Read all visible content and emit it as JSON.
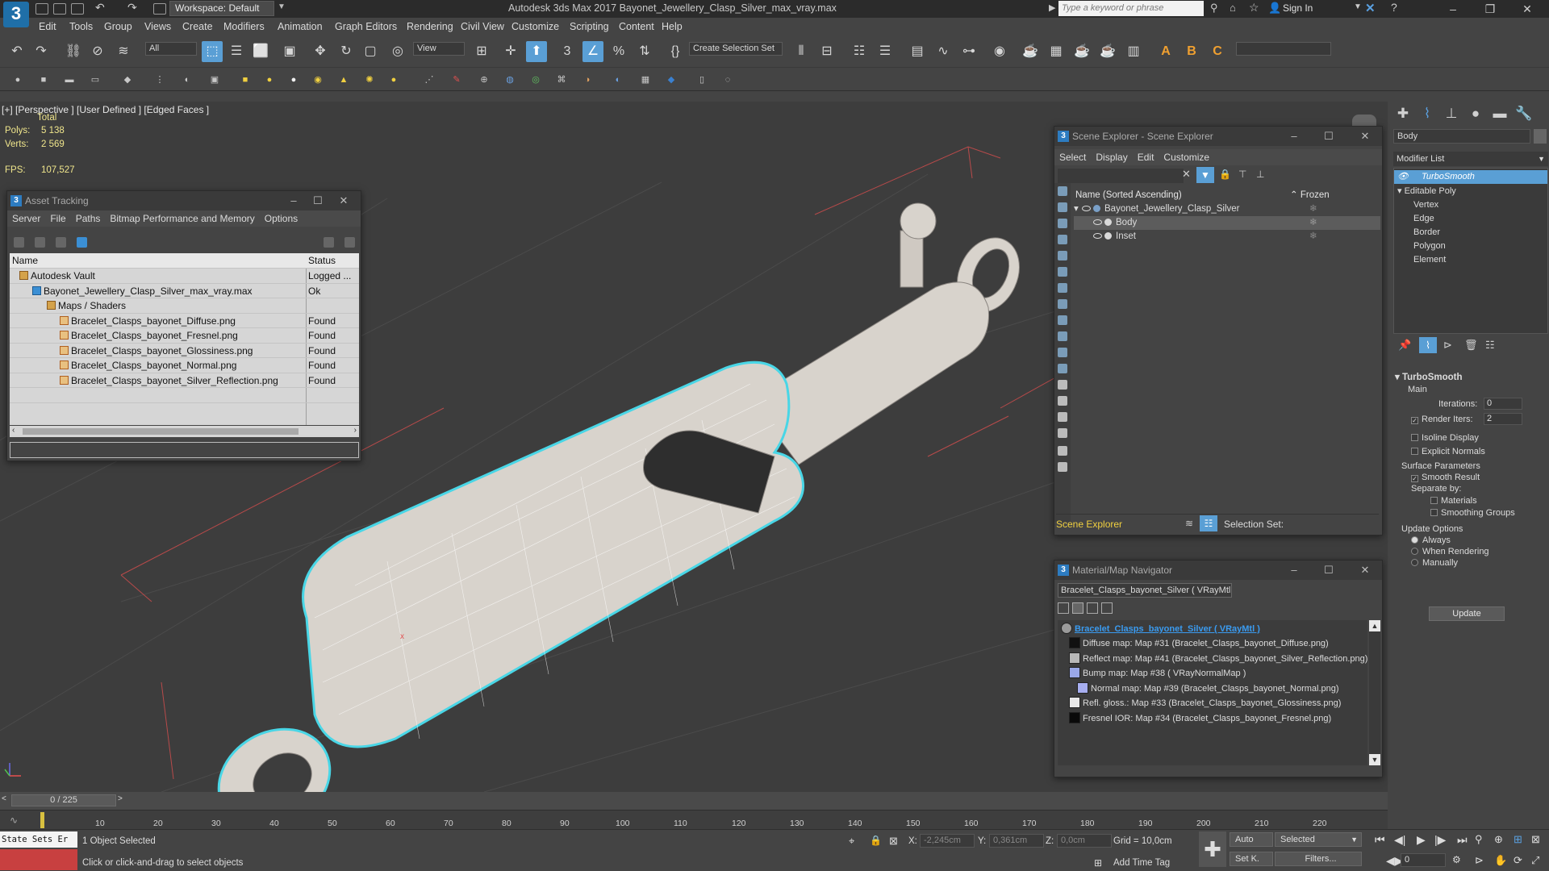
{
  "titlebar": {
    "logo": "3",
    "workspace": "Workspace: Default",
    "app_title": "Autodesk 3ds Max 2017     Bayonet_Jewellery_Clasp_Silver_max_vray.max",
    "search_placeholder": "Type a keyword or phrase",
    "sign_in": "Sign In"
  },
  "menu": [
    "Edit",
    "Tools",
    "Group",
    "Views",
    "Create",
    "Modifiers",
    "Animation",
    "Graph Editors",
    "Rendering",
    "Civil View",
    "Customize",
    "Scripting",
    "Content",
    "Help"
  ],
  "toolbar": {
    "selection_filter": "All",
    "ref_coord": "View",
    "named_selection": "Create Selection Set"
  },
  "viewport": {
    "label": "[+] [Perspective ]  [User Defined ]  [Edged Faces ]",
    "stats_header": "Total",
    "polys_label": "Polys:",
    "polys_value": "5 138",
    "verts_label": "Verts:",
    "verts_value": "2 569",
    "fps_label": "FPS:",
    "fps_value": "107,527",
    "object_color": "#d8d3cc",
    "selection_outline": "#49d6e6",
    "wire_color": "#ffffff"
  },
  "asset_tracking": {
    "title": "Asset Tracking",
    "menu": [
      "Server",
      "File",
      "Paths",
      "Bitmap Performance and Memory",
      "Options"
    ],
    "col_name": "Name",
    "col_status": "Status",
    "rows": [
      {
        "name": "Autodesk Vault",
        "status": "Logged ...",
        "indent": 0,
        "icon": "vault-icon"
      },
      {
        "name": "Bayonet_Jewellery_Clasp_Silver_max_vray.max",
        "status": "Ok",
        "indent": 1,
        "icon": "max-file-icon"
      },
      {
        "name": "Maps / Shaders",
        "status": "",
        "indent": 2,
        "icon": "folder-icon"
      },
      {
        "name": "Bracelet_Clasps_bayonet_Diffuse.png",
        "status": "Found",
        "indent": 3,
        "icon": "texture-icon"
      },
      {
        "name": "Bracelet_Clasps_bayonet_Fresnel.png",
        "status": "Found",
        "indent": 3,
        "icon": "texture-icon"
      },
      {
        "name": "Bracelet_Clasps_bayonet_Glossiness.png",
        "status": "Found",
        "indent": 3,
        "icon": "texture-icon"
      },
      {
        "name": "Bracelet_Clasps_bayonet_Normal.png",
        "status": "Found",
        "indent": 3,
        "icon": "texture-icon"
      },
      {
        "name": "Bracelet_Clasps_bayonet_Silver_Reflection.png",
        "status": "Found",
        "indent": 3,
        "icon": "texture-icon"
      }
    ]
  },
  "scene_explorer": {
    "title": "Scene Explorer - Scene Explorer",
    "menu": [
      "Select",
      "Display",
      "Edit",
      "Customize"
    ],
    "col_name": "Name (Sorted Ascending)",
    "col_frozen": "Frozen",
    "items": [
      {
        "name": "Bayonet_Jewellery_Clasp_Silver",
        "indent": 0,
        "selected": false
      },
      {
        "name": "Body",
        "indent": 1,
        "selected": true
      },
      {
        "name": "Inset",
        "indent": 1,
        "selected": false
      }
    ],
    "footer_label": "Scene Explorer",
    "selection_set_label": "Selection Set:"
  },
  "material_navigator": {
    "title": "Material/Map Navigator",
    "current": "Bracelet_Clasps_bayonet_Silver  ( VRayMtl )",
    "tree": [
      {
        "text": "Bracelet_Clasps_bayonet_Silver  ( VRayMtl )",
        "indent": 0,
        "swatch": "#9a9a9a",
        "root": true
      },
      {
        "text": "Diffuse map: Map #31 (Bracelet_Clasps_bayonet_Diffuse.png)",
        "indent": 1,
        "swatch": "#111111"
      },
      {
        "text": "Reflect map: Map #41 (Bracelet_Clasps_bayonet_Silver_Reflection.png)",
        "indent": 1,
        "swatch": "#b8b8b8"
      },
      {
        "text": "Bump map: Map #38  ( VRayNormalMap )",
        "indent": 1,
        "swatch": "#9aa8e8"
      },
      {
        "text": "Normal map: Map #39 (Bracelet_Clasps_bayonet_Normal.png)",
        "indent": 2,
        "swatch": "#a7aef0"
      },
      {
        "text": "Refl. gloss.: Map #33 (Bracelet_Clasps_bayonet_Glossiness.png)",
        "indent": 1,
        "swatch": "#e8e8e8"
      },
      {
        "text": "Fresnel IOR: Map #34 (Bracelet_Clasps_bayonet_Fresnel.png)",
        "indent": 1,
        "swatch": "#0a0a0a"
      }
    ]
  },
  "command_panel": {
    "object_name": "Body",
    "modifier_list": "Modifier List",
    "stack": [
      {
        "label": "TurboSmooth",
        "indent": 0,
        "selected": true
      },
      {
        "label": "Editable Poly",
        "indent": 0,
        "selected": false
      },
      {
        "label": "Vertex",
        "indent": 1,
        "selected": false
      },
      {
        "label": "Edge",
        "indent": 1,
        "selected": false
      },
      {
        "label": "Border",
        "indent": 1,
        "selected": false
      },
      {
        "label": "Polygon",
        "indent": 1,
        "selected": false
      },
      {
        "label": "Element",
        "indent": 1,
        "selected": false
      }
    ],
    "rollout_title": "TurboSmooth",
    "main_label": "Main",
    "iterations_label": "Iterations:",
    "iterations_value": "0",
    "render_iters_label": "Render Iters:",
    "render_iters_value": "2",
    "render_iters_checked": true,
    "isoline_label": "Isoline Display",
    "explicit_normals_label": "Explicit Normals",
    "surface_params_label": "Surface Parameters",
    "smooth_result_label": "Smooth Result",
    "separate_by_label": "Separate by:",
    "materials_label": "Materials",
    "smoothing_groups_label": "Smoothing Groups",
    "update_options_label": "Update Options",
    "always_label": "Always",
    "when_rendering_label": "When Rendering",
    "manually_label": "Manually",
    "update_button": "Update"
  },
  "timeline": {
    "frame_display": "0 / 225",
    "ticks": [
      "10",
      "20",
      "30",
      "40",
      "50",
      "60",
      "70",
      "80",
      "90",
      "100",
      "110",
      "120",
      "130",
      "140",
      "150",
      "160",
      "170",
      "180",
      "190",
      "200",
      "210",
      "220"
    ]
  },
  "status": {
    "maxscript": "State Sets Er",
    "selected_count": "1 Object Selected",
    "prompt": "Click or click-and-drag to select objects",
    "x_label": "X:",
    "x_value": "-2,245cm",
    "y_label": "Y:",
    "y_value": "0,361cm",
    "z_label": "Z:",
    "z_value": "0,0cm",
    "grid": "Grid = 10,0cm",
    "add_time_tag": "Add Time Tag",
    "auto_key": "Auto",
    "set_key": "Set K.",
    "key_filter": "Selected",
    "filters": "Filters...",
    "current_frame": "0"
  }
}
